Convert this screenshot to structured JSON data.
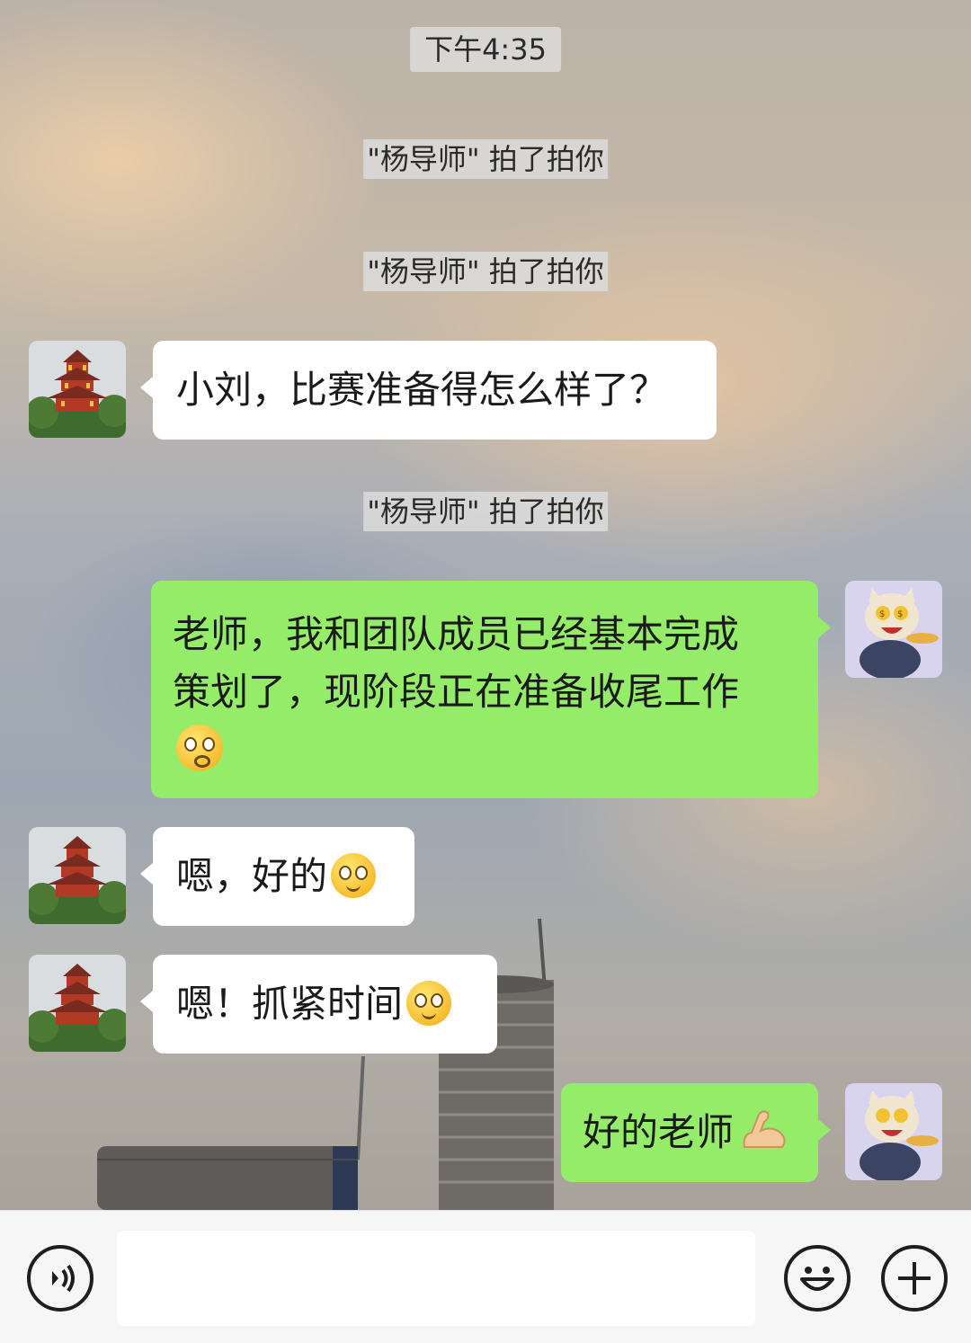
{
  "chat": {
    "timestamp": "下午4:35",
    "messages": [
      {
        "type": "system",
        "text": "\"杨导师\" 拍了拍你"
      },
      {
        "type": "system",
        "text": "\"杨导师\" 拍了拍你"
      },
      {
        "type": "incoming",
        "text": "小刘，比赛准备得怎么样了？"
      },
      {
        "type": "system",
        "text": "\"杨导师\" 拍了拍你"
      },
      {
        "type": "outgoing",
        "lines": [
          "老师，我和团队成员已经基本完成",
          "策划了，现阶段正在准备收尾工作"
        ],
        "emoji": "flushed-face"
      },
      {
        "type": "incoming",
        "text": "嗯，好的",
        "emoji": "smiling-face"
      },
      {
        "type": "incoming",
        "text": "嗯！抓紧时间",
        "emoji": "smiling-face"
      },
      {
        "type": "outgoing",
        "text": "好的老师",
        "emoji": "flexed-biceps"
      }
    ]
  },
  "avatars": {
    "contact": "pagoda-avatar",
    "self": "cartoon-cat-avatar"
  },
  "input_bar": {
    "voice_icon": "voice-icon",
    "text_value": "",
    "emoji_icon": "emoji-icon",
    "plus_icon": "plus-icon"
  }
}
